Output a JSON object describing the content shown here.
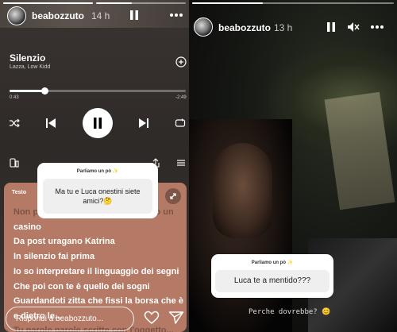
{
  "left_story": {
    "username": "beabozzuto",
    "time": "14 h",
    "song": {
      "title": "Silenzio",
      "artists": "Lazza, Low Kidd",
      "elapsed": "0:43",
      "remaining": "-2:49",
      "progress": 0.2
    },
    "lyrics": {
      "label": "Testo",
      "lines": [
        "Non prometto parole ma in testa ho un",
        "casino",
        "Da post uragano Katrina",
        "In silenzio fai prima",
        "Io so interpretare il linguaggio dei segni",
        "Che poi con te è quello dei sogni",
        "Guardandoti zitta che fissi la borsa che è",
        "e dietro le...",
        "Tu parole parole scritte con l'oggetto..."
      ]
    },
    "question": {
      "header": "Parliamo un pò ✨",
      "text": "Ma tu e Luca onestini siete amici?🤔"
    },
    "reply_placeholder": "Rispondi a beabozzuto..."
  },
  "right_story": {
    "username": "beabozzuto",
    "time": "13 h",
    "question": {
      "header": "Parliamo un pò ✨",
      "text": "Luca te a mentido???"
    },
    "answer": "Perche dovrebbe? 😊"
  },
  "colors": {
    "lyrics_bg": "#b57a66",
    "accent": "#ffffff"
  }
}
